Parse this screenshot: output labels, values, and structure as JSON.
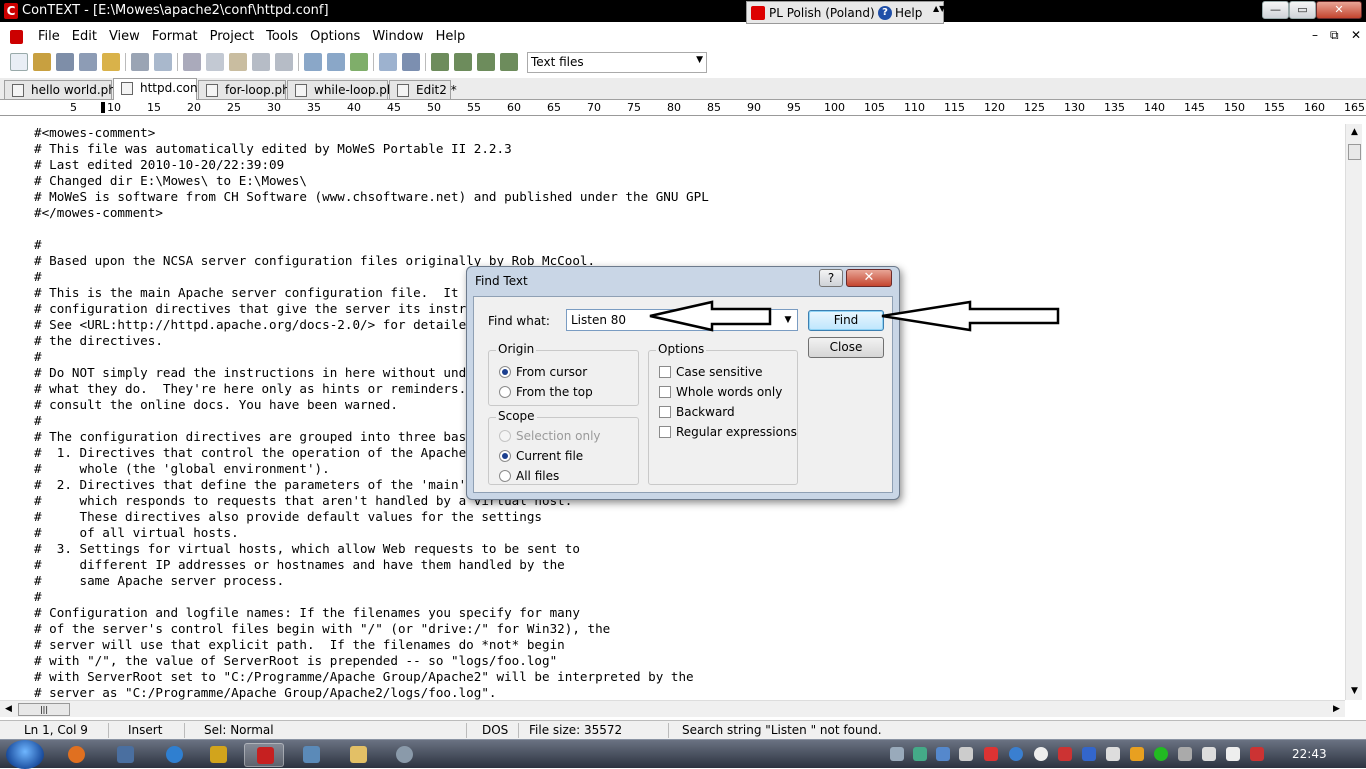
{
  "window": {
    "title": "ConTEXT - [E:\\Mowes\\apache2\\conf\\httpd.conf]",
    "app_icon_letter": "C",
    "controls": [
      "—",
      "▭",
      "✕"
    ]
  },
  "language_bar": {
    "language": "PL Polish (Poland)",
    "help": "Help",
    "help_icon_glyph": "?",
    "grip": "▲▼"
  },
  "menu": {
    "items": [
      "File",
      "Edit",
      "View",
      "Format",
      "Project",
      "Tools",
      "Options",
      "Window",
      "Help"
    ],
    "mdi_controls": [
      "–",
      "⧉",
      "✕"
    ]
  },
  "toolbar": {
    "file_filter": "Text files",
    "filter_arrow": "▼"
  },
  "tabs": [
    {
      "label": "hello world.php *",
      "active": false
    },
    {
      "label": "httpd.conf",
      "active": true
    },
    {
      "label": "for-loop.php",
      "active": false
    },
    {
      "label": "while-loop.php",
      "active": false
    },
    {
      "label": "Edit2 *",
      "active": false
    }
  ],
  "ruler": {
    "ticks": [
      "5",
      "10",
      "15",
      "20",
      "25",
      "30",
      "35",
      "40",
      "45",
      "50",
      "55",
      "60",
      "65",
      "70",
      "75",
      "80",
      "85",
      "90",
      "95",
      "100",
      "105",
      "110",
      "115",
      "120",
      "125",
      "130",
      "135",
      "140",
      "145",
      "150",
      "155",
      "160",
      "165"
    ]
  },
  "editor": {
    "lines": [
      "#<mowes-comment>",
      "# This file was automatically edited by MoWeS Portable II 2.2.3",
      "# Last edited 2010-10-20/22:39:09",
      "# Changed dir E:\\Mowes\\ to E:\\Mowes\\",
      "# MoWeS is software from CH Software (www.chsoftware.net) and published under the GNU GPL",
      "#</mowes-comment>",
      "",
      "#",
      "# Based upon the NCSA server configuration files originally by Rob McCool.",
      "#",
      "# This is the main Apache server configuration file.  It contains the",
      "# configuration directives that give the server its instructions.",
      "# See <URL:http://httpd.apache.org/docs-2.0/> for detailed information about",
      "# the directives.",
      "#",
      "# Do NOT simply read the instructions in here without understanding",
      "# what they do.  They're here only as hints or reminders.  If you are unsure",
      "# consult the online docs. You have been warned.",
      "#",
      "# The configuration directives are grouped into three basic sections:",
      "#  1. Directives that control the operation of the Apache server process as a",
      "#     whole (the 'global environment').",
      "#  2. Directives that define the parameters of the 'main' or 'default' server,",
      "#     which responds to requests that aren't handled by a virtual host.",
      "#     These directives also provide default values for the settings",
      "#     of all virtual hosts.",
      "#  3. Settings for virtual hosts, which allow Web requests to be sent to",
      "#     different IP addresses or hostnames and have them handled by the",
      "#     same Apache server process.",
      "#",
      "# Configuration and logfile names: If the filenames you specify for many",
      "# of the server's control files begin with \"/\" (or \"drive:/\" for Win32), the",
      "# server will use that explicit path.  If the filenames do *not* begin",
      "# with \"/\", the value of ServerRoot is prepended -- so \"logs/foo.log\"",
      "# with ServerRoot set to \"C:/Programme/Apache Group/Apache2\" will be interpreted by the",
      "# server as \"C:/Programme/Apache Group/Apache2/logs/foo.log\"."
    ]
  },
  "scrollbars": {
    "up": "▲",
    "down": "▼",
    "left": "◀",
    "right": "▶",
    "hthumb_grip": "|||"
  },
  "find_dialog": {
    "title": "Find Text",
    "help_glyph": "?",
    "close_glyph": "✕",
    "find_what_label": "Find what:",
    "find_what_value": "Listen 80",
    "combo_arrow": "▼",
    "find_button": "Find",
    "close_button": "Close",
    "origin": {
      "title": "Origin",
      "options": [
        {
          "label": "From cursor",
          "selected": true
        },
        {
          "label": "From the top",
          "selected": false
        }
      ]
    },
    "scope": {
      "title": "Scope",
      "options": [
        {
          "label": "Selection only",
          "selected": false,
          "disabled": true
        },
        {
          "label": "Current file",
          "selected": true,
          "disabled": false
        },
        {
          "label": "All files",
          "selected": false,
          "disabled": false
        }
      ]
    },
    "options": {
      "title": "Options",
      "items": [
        {
          "label": "Case sensitive",
          "checked": false
        },
        {
          "label": "Whole words only",
          "checked": false
        },
        {
          "label": "Backward",
          "checked": false
        },
        {
          "label": "Regular expressions",
          "checked": false
        }
      ]
    }
  },
  "status_bar": {
    "position": "Ln 1, Col 9",
    "mode": "Insert",
    "selection": "Sel: Normal",
    "line_ending": "DOS",
    "file_size": "File size: 35572",
    "message": "Search string \"Listen \" not found."
  },
  "taskbar": {
    "clock": "22:43"
  }
}
